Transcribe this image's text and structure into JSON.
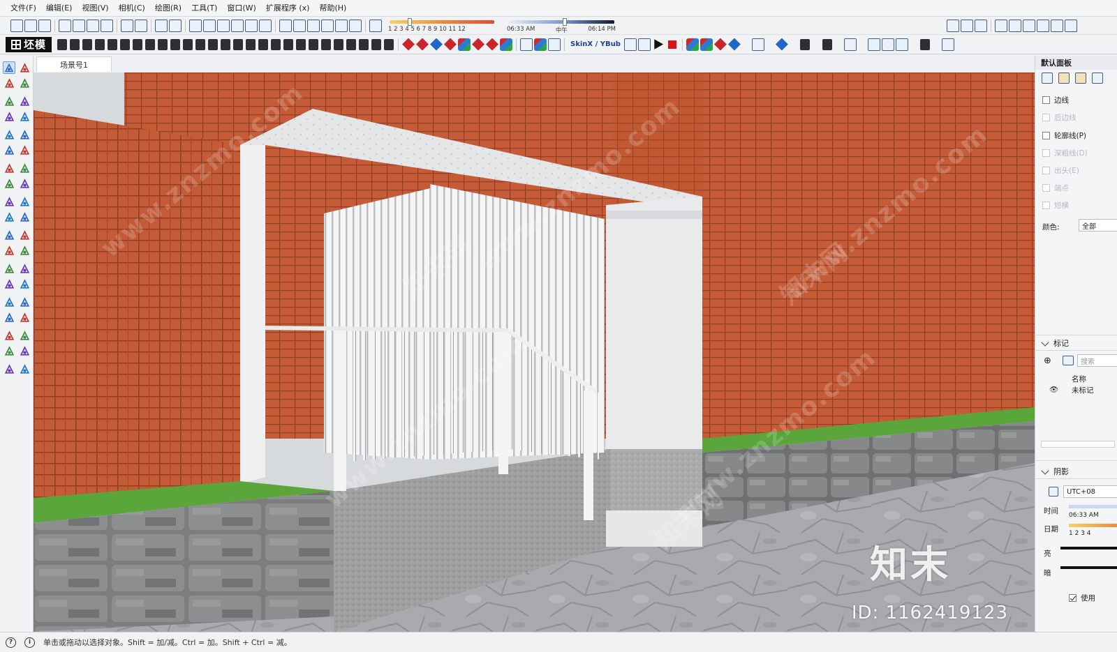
{
  "menu": [
    "文件(F)",
    "编辑(E)",
    "视图(V)",
    "相机(C)",
    "绘图(R)",
    "工具(T)",
    "窗口(W)",
    "扩展程序 (x)",
    "帮助(H)"
  ],
  "toolbar": {
    "shadow_months": "1 2 3 4 5 6 7 8 9 10 11 12",
    "shadow_time_start": "06:33 AM",
    "shadow_time_mid": "中午",
    "shadow_time_end": "06:14 PM",
    "logo_label": "坯模",
    "skinx_label": "SkinX / YBub"
  },
  "scene_tab": "场景号1",
  "right_panel": {
    "title": "默认面板",
    "styles_checks": [
      {
        "label": "边线",
        "checked": false,
        "enabled": true
      },
      {
        "label": "后边线",
        "checked": false,
        "enabled": false
      },
      {
        "label": "轮廓线(P)",
        "checked": false,
        "enabled": true
      },
      {
        "label": "深粗线(D)",
        "checked": false,
        "enabled": false
      },
      {
        "label": "出头(E)",
        "checked": false,
        "enabled": false
      },
      {
        "label": "端点",
        "checked": false,
        "enabled": false
      },
      {
        "label": "短横",
        "checked": false,
        "enabled": false
      }
    ],
    "color_label": "颜色:",
    "color_value": "全部",
    "tags_title": "标记",
    "tags_search_placeholder": "搜索",
    "tags_col_name": "名称",
    "tags_row_untagged": "未标记",
    "shadow_title": "阴影",
    "shadow_timezone": "UTC+08",
    "shadow_time_label": "时间",
    "shadow_time_value": "06:33 AM",
    "shadow_date_label": "日期",
    "shadow_date_ticks": "1 2 3 4",
    "shadow_light_label": "亮",
    "shadow_dark_label": "暗",
    "shadow_use_label": "使用"
  },
  "status_bar": {
    "hint": "单击或拖动以选择对象。Shift = 加/减。Ctrl = 加。Shift + Ctrl = 减。"
  },
  "watermark": {
    "brand": "知末",
    "id": "ID: 1162419123",
    "url": "www.znzmo.com",
    "site": "知末网"
  },
  "colors": {
    "brick": "#c25a36",
    "mortar": "#8c3d24",
    "grass": "#5aa63a",
    "stone": "#8a8b8d",
    "concrete": "#a9a9a9",
    "canopy": "#ebebed"
  }
}
